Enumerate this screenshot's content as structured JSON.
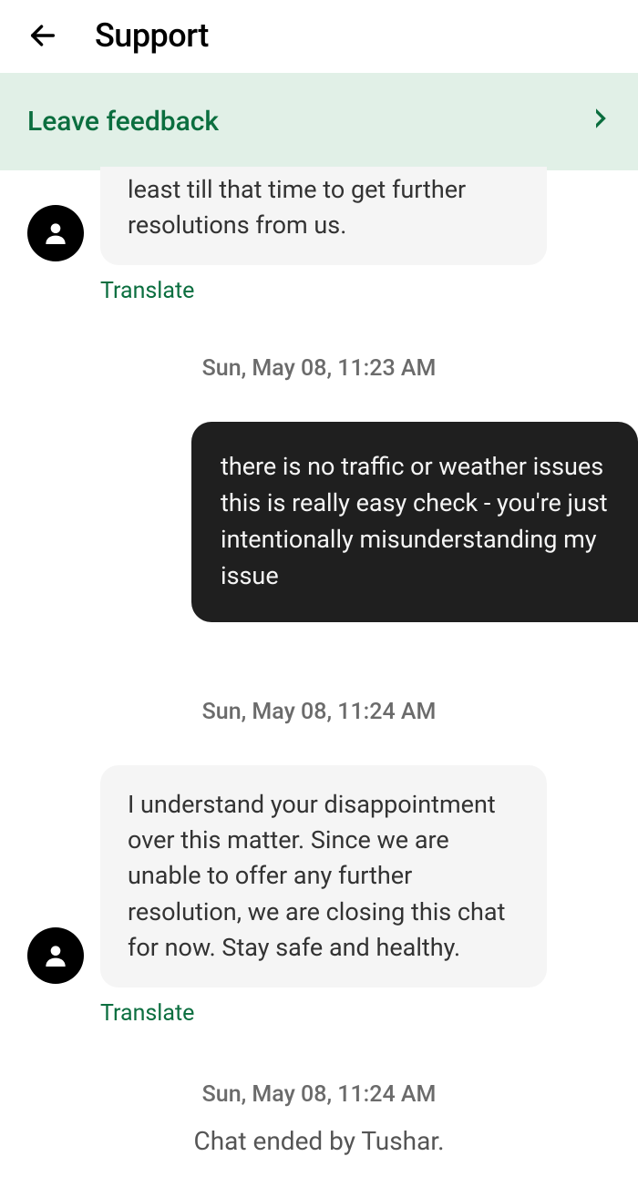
{
  "header": {
    "title": "Support"
  },
  "feedback": {
    "label": "Leave feedback"
  },
  "messages": {
    "agent1": {
      "text": "least till that time to get further resolutions from us.",
      "translate": "Translate"
    },
    "ts1": "Sun, May 08, 11:23 AM",
    "user1": {
      "text": "there is no traffic or weather issues this is really easy check - you're just intentionally misunderstanding my issue"
    },
    "ts2": "Sun, May 08, 11:24 AM",
    "agent2": {
      "text": "I understand your disappointment over this matter. Since we are unable to offer any further resolution, we are closing this chat for now. Stay safe and healthy.",
      "translate": "Translate"
    },
    "ts3": "Sun, May 08, 11:24 AM",
    "system": "Chat ended by Tushar."
  }
}
